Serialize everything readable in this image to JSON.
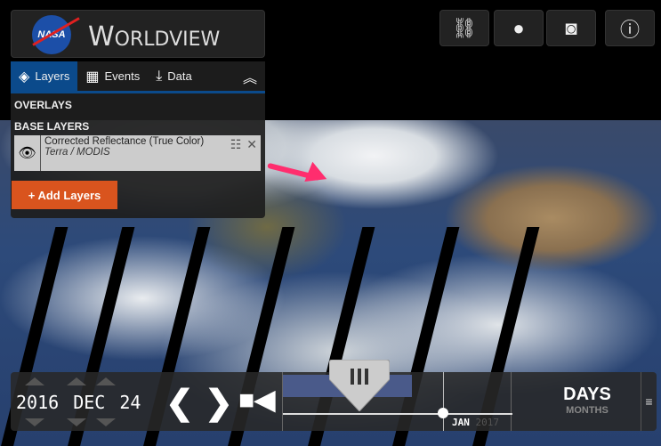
{
  "app": {
    "logo_text": "NASA",
    "title_initial": "W",
    "title_rest": "ORLDVIEW"
  },
  "toolbar": [
    {
      "name": "link-icon",
      "glyph": "🔗"
    },
    {
      "name": "globe-icon",
      "glyph": "🌎"
    },
    {
      "name": "camera-icon",
      "glyph": "📷"
    },
    {
      "name": "info-icon",
      "glyph": "ℹ"
    }
  ],
  "tabs": [
    {
      "label": "Layers",
      "icon": "layers-icon"
    },
    {
      "label": "Events",
      "icon": "calendar-icon"
    },
    {
      "label": "Data",
      "icon": "download-icon"
    }
  ],
  "sections": {
    "overlays": "OVERLAYS",
    "base_layers": "BASE LAYERS"
  },
  "layer": {
    "title": "Corrected Reflectance (True Color)",
    "subtitle": "Terra / MODIS"
  },
  "add_layers": "+ Add Layers",
  "timeline": {
    "year": "2016",
    "month": "DEC",
    "day": "24",
    "axis_month": "JAN",
    "axis_year": "2017",
    "zoom_selected": "DAYS",
    "zoom_other": "MONTHS"
  },
  "colors": {
    "accent": "#0b4a8b",
    "add_button": "#d9541e",
    "annotation_arrow": "#ff2d6e"
  }
}
